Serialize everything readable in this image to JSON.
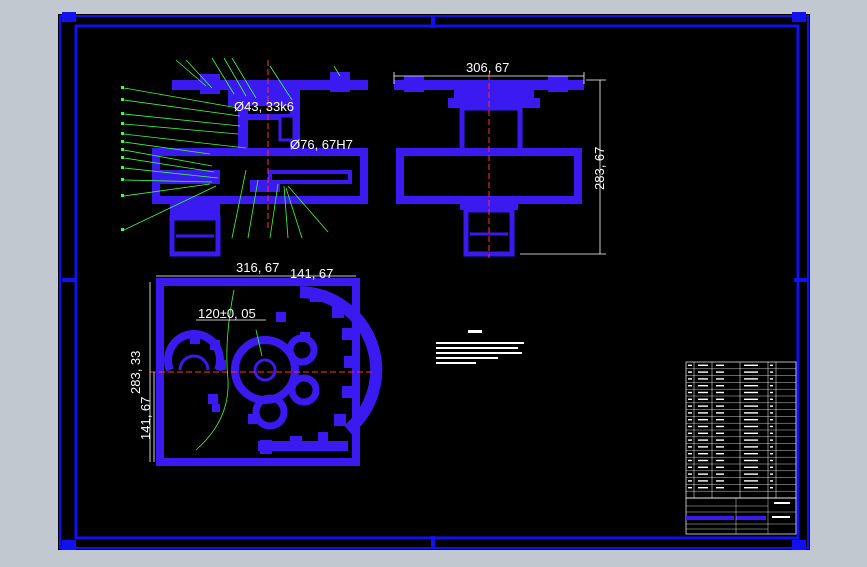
{
  "dimensions": {
    "top_width": "306, 67",
    "side_height": "283, 67",
    "shaft_dia": "Ø43, 33k6",
    "bore_dia": "Ø76, 67H7",
    "plan_width": "316, 67",
    "plan_half": "141, 67",
    "center_dist": "120±0, 05",
    "plan_height": "283, 33",
    "plan_half_height": "141, 67"
  },
  "colors": {
    "background": "#c2c8d0",
    "sheet": "#000000",
    "border": "#1010f0",
    "part": "#3a1af0",
    "leader": "#3cff3c",
    "dim_line": "#ffffff",
    "center_line": "#ff3030"
  }
}
